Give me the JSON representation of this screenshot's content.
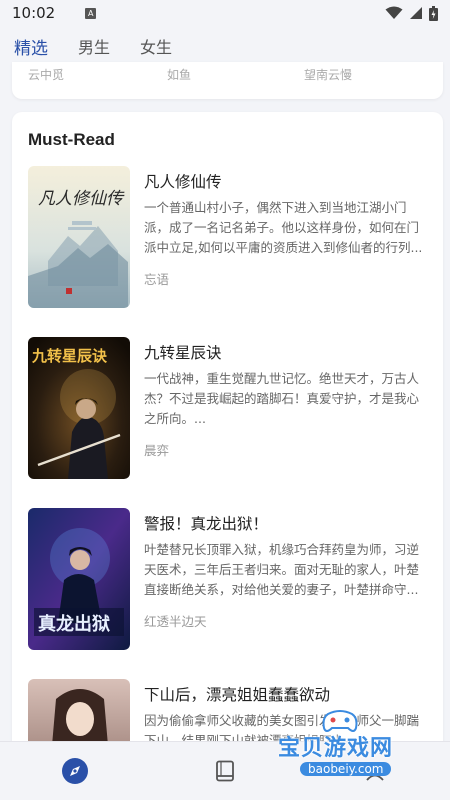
{
  "status_bar": {
    "time": "10:02",
    "notif_letter": "A"
  },
  "tabs": [
    {
      "label": "精选",
      "active": true
    },
    {
      "label": "男生",
      "active": false
    },
    {
      "label": "女生",
      "active": false
    }
  ],
  "top_card": {
    "authors": [
      "云中觅",
      "如鱼",
      "望南云慢"
    ]
  },
  "section": {
    "title": "Must-Read",
    "books": [
      {
        "title": "凡人修仙传",
        "description": "一个普通山村小子，偶然下进入到当地江湖小门派，成了一名记名弟子。他以这样身份，如何在门派中立足,如何以平庸的资质进入到修仙者的行列...",
        "author": "忘语",
        "cover_text": "凡人修仙传"
      },
      {
        "title": "九转星辰诀",
        "description": "一代战神，重生觉醒九世记忆。绝世天才，万古人杰？不过是我崛起的踏脚石！真爱守护，才是我心之所向。...",
        "author": "晨弈",
        "cover_text": "九转星辰诀"
      },
      {
        "title": "警报！真龙出狱！",
        "description": "叶楚替兄长顶罪入狱，机缘巧合拜药皇为师，习逆天医术，三年后王者归来。面对无耻的家人，叶楚直接断绝关系，对给他关爱的妻子，叶楚拼命守...",
        "author": "红透半边天",
        "cover_text": "真龙出狱"
      },
      {
        "title": "下山后，漂亮姐姐蠢蠢欲动",
        "description": "因为偷偷拿师父收藏的美女图引发尘被师父一脚踹下山，结果刚下山就被漂亮姐姐盯上...",
        "author": "",
        "cover_text": ""
      }
    ]
  },
  "bottom_nav": [
    {
      "icon": "compass-icon",
      "active": true
    },
    {
      "icon": "book-icon",
      "active": false
    }
  ],
  "watermark": {
    "text": "宝贝游戏网",
    "url": "baobeiy.com"
  },
  "colors": {
    "accent": "#2a50a8",
    "background": "#f3f4f8"
  }
}
